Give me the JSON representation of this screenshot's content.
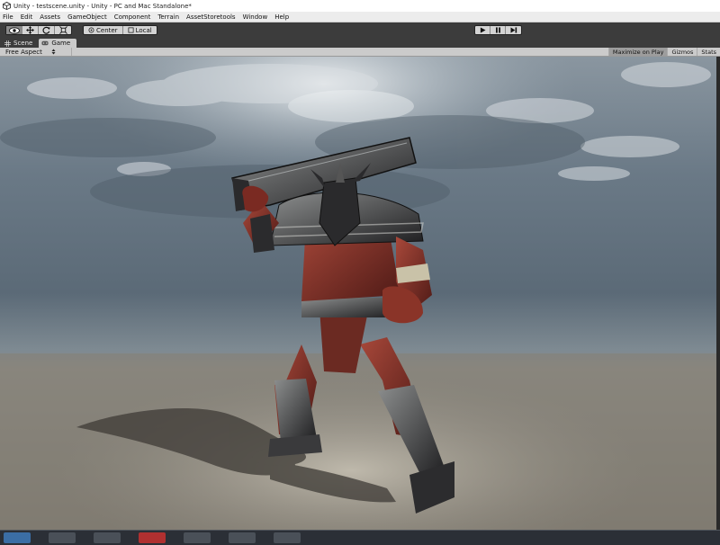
{
  "window": {
    "title": "Unity - testscene.unity - Unity - PC and Mac Standalone*"
  },
  "menu": [
    "File",
    "Edit",
    "Assets",
    "GameObject",
    "Component",
    "Terrain",
    "AssetStoretools",
    "Window",
    "Help"
  ],
  "toolbar": {
    "tools": [
      {
        "name": "hand-tool-button",
        "icon": "eye-icon"
      },
      {
        "name": "move-tool-button",
        "icon": "move-arrows-icon"
      },
      {
        "name": "rotate-tool-button",
        "icon": "rotate-icon"
      },
      {
        "name": "scale-tool-button",
        "icon": "scale-icon"
      }
    ],
    "pivot_label": "Center",
    "space_label": "Local"
  },
  "tabs": {
    "scene_label": "Scene",
    "game_label": "Game"
  },
  "game_view": {
    "aspect_label": "Free Aspect",
    "maximize_label": "Maximize on Play",
    "gizmos_label": "Gizmos",
    "stats_label": "Stats"
  },
  "colors": {
    "toolbar_bg": "#3c3c3c",
    "panel_bg": "#cbcbcb",
    "sky_top": "#5d6e7f",
    "ground": "#8e8b83",
    "character_red": "#7a2a22",
    "taskbar_bg": "#2b2f36"
  }
}
